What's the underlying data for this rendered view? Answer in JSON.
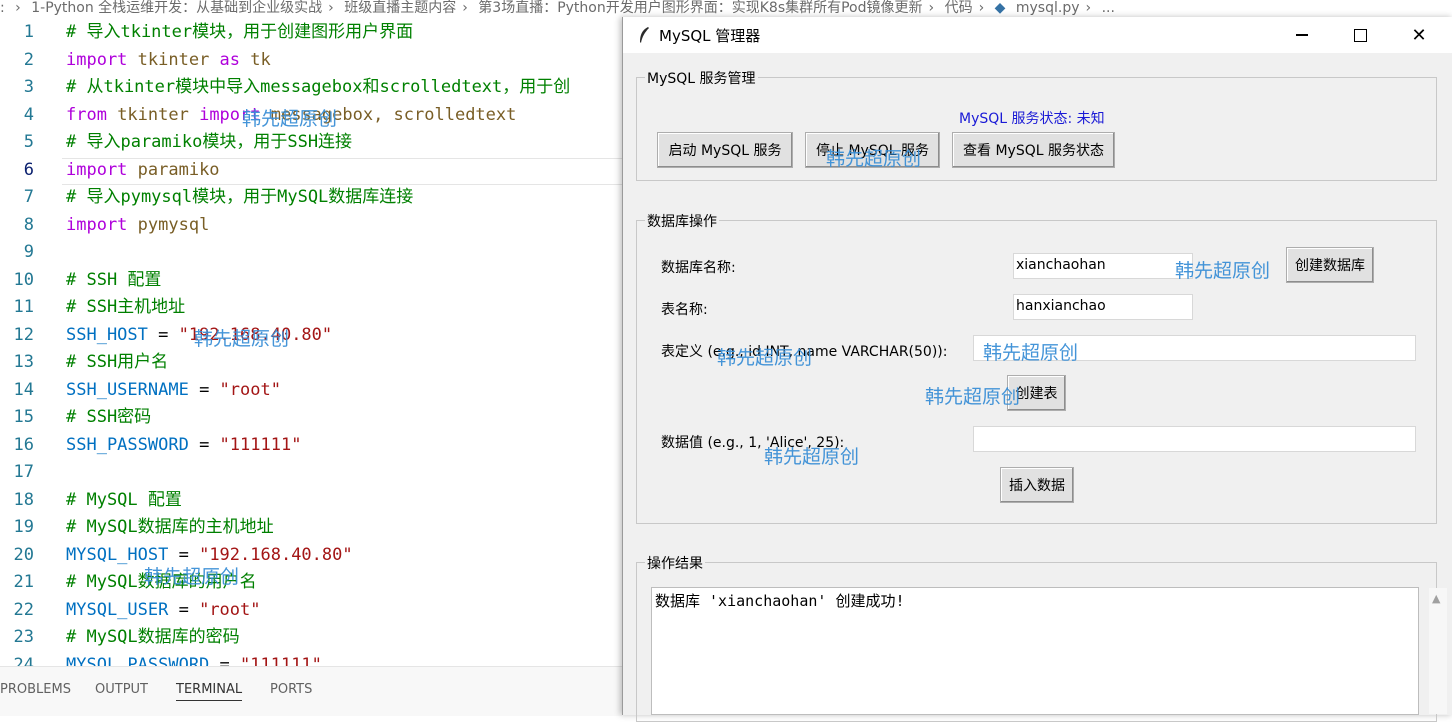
{
  "breadcrumb": [
    ": ",
    "1-Python 全栈运维开发：从基础到企业级实战",
    "班级直播主题内容",
    "第3场直播：Python开发用户图形界面：实现K8s集群所有Pod镜像更新",
    "代码",
    "mysql.py",
    "..."
  ],
  "editor": {
    "lines": [
      {
        "n": "1",
        "segs": [
          {
            "t": "# 导入tkinter模块，用于创建图形用户界面",
            "c": "c-com"
          }
        ]
      },
      {
        "n": "2",
        "segs": [
          {
            "t": "import",
            "c": "c-kw"
          },
          {
            "t": " tkinter ",
            "c": "c-txt"
          },
          {
            "t": "as",
            "c": "c-kw"
          },
          {
            "t": " tk",
            "c": "c-txt"
          }
        ]
      },
      {
        "n": "3",
        "segs": [
          {
            "t": "# 从tkinter模块中导入messagebox和scrolledtext，用于创",
            "c": "c-com"
          }
        ]
      },
      {
        "n": "4",
        "segs": [
          {
            "t": "from",
            "c": "c-kw"
          },
          {
            "t": " tkinter ",
            "c": "c-txt"
          },
          {
            "t": "import",
            "c": "c-kw"
          },
          {
            "t": " messagebox, scrolledtext",
            "c": "c-txt"
          }
        ]
      },
      {
        "n": "5",
        "segs": [
          {
            "t": "# 导入paramiko模块，用于SSH连接",
            "c": "c-com"
          }
        ]
      },
      {
        "n": "6",
        "segs": [
          {
            "t": "import",
            "c": "c-kw"
          },
          {
            "t": " paramiko",
            "c": "c-txt"
          }
        ]
      },
      {
        "n": "7",
        "segs": [
          {
            "t": "# 导入pymysql模块，用于MySQL数据库连接",
            "c": "c-com"
          }
        ]
      },
      {
        "n": "8",
        "segs": [
          {
            "t": "import",
            "c": "c-kw"
          },
          {
            "t": " pymysql",
            "c": "c-txt"
          }
        ]
      },
      {
        "n": "9",
        "segs": []
      },
      {
        "n": "10",
        "segs": [
          {
            "t": "# SSH 配置",
            "c": "c-com"
          }
        ]
      },
      {
        "n": "11",
        "segs": [
          {
            "t": "# SSH主机地址",
            "c": "c-com"
          }
        ]
      },
      {
        "n": "12",
        "segs": [
          {
            "t": "SSH_HOST",
            "c": "c-var"
          },
          {
            "t": " = ",
            "c": "c-plain"
          },
          {
            "t": "\"192.168.40.80\"",
            "c": "c-str"
          }
        ]
      },
      {
        "n": "13",
        "segs": [
          {
            "t": "# SSH用户名",
            "c": "c-com"
          }
        ]
      },
      {
        "n": "14",
        "segs": [
          {
            "t": "SSH_USERNAME",
            "c": "c-var"
          },
          {
            "t": " = ",
            "c": "c-plain"
          },
          {
            "t": "\"root\"",
            "c": "c-str"
          }
        ]
      },
      {
        "n": "15",
        "segs": [
          {
            "t": "# SSH密码",
            "c": "c-com"
          }
        ]
      },
      {
        "n": "16",
        "segs": [
          {
            "t": "SSH_PASSWORD",
            "c": "c-var"
          },
          {
            "t": " = ",
            "c": "c-plain"
          },
          {
            "t": "\"111111\"",
            "c": "c-str"
          }
        ]
      },
      {
        "n": "17",
        "segs": []
      },
      {
        "n": "18",
        "segs": [
          {
            "t": "# MySQL 配置",
            "c": "c-com"
          }
        ]
      },
      {
        "n": "19",
        "segs": [
          {
            "t": "# MySQL数据库的主机地址",
            "c": "c-com"
          }
        ]
      },
      {
        "n": "20",
        "segs": [
          {
            "t": "MYSQL_HOST",
            "c": "c-var"
          },
          {
            "t": " = ",
            "c": "c-plain"
          },
          {
            "t": "\"192.168.40.80\"",
            "c": "c-str"
          }
        ]
      },
      {
        "n": "21",
        "segs": [
          {
            "t": "# MySQL数据库的用户名",
            "c": "c-com"
          }
        ]
      },
      {
        "n": "22",
        "segs": [
          {
            "t": "MYSQL_USER",
            "c": "c-var"
          },
          {
            "t": " = ",
            "c": "c-plain"
          },
          {
            "t": "\"root\"",
            "c": "c-str"
          }
        ]
      },
      {
        "n": "23",
        "segs": [
          {
            "t": "# MySQL数据库的密码",
            "c": "c-com"
          }
        ]
      },
      {
        "n": "24",
        "segs": [
          {
            "t": "MYSQL_PASSWORD",
            "c": "c-var"
          },
          {
            "t": " = ",
            "c": "c-plain"
          },
          {
            "t": "\"111111\"",
            "c": "c-str"
          }
        ]
      }
    ],
    "current_line": "6"
  },
  "panel_tabs": {
    "problems": "PROBLEMS",
    "output": "OUTPUT",
    "terminal": "TERMINAL",
    "ports": "PORTS"
  },
  "window": {
    "title": "MySQL 管理器",
    "service_frame": {
      "label": "MySQL 服务管理",
      "status": "MySQL 服务状态: 未知",
      "start_btn": "启动 MySQL 服务",
      "stop_btn": "停止 MySQL 服务",
      "check_btn": "查看 MySQL 服务状态"
    },
    "db_frame": {
      "label": "数据库操作",
      "db_name_label": "数据库名称:",
      "db_name_value": "xianchaohan",
      "create_db_btn": "创建数据库",
      "table_name_label": "表名称:",
      "table_name_value": "hanxianchao",
      "table_def_label": "表定义 (e.g., id INT, name VARCHAR(50)):",
      "table_def_value": "",
      "create_table_btn": "创建表",
      "data_label": "数据值 (e.g., 1, 'Alice', 25):",
      "data_value": "",
      "insert_btn": "插入数据"
    },
    "result_frame": {
      "label": "操作结果",
      "text": "数据库 'xianchaohan' 创建成功!"
    }
  },
  "watermark": "韩先超原创",
  "colors": {
    "status_blue": "#1a1ad6",
    "watermark": "#3a8fd6",
    "comment": "#008000",
    "keyword": "#af00db"
  }
}
